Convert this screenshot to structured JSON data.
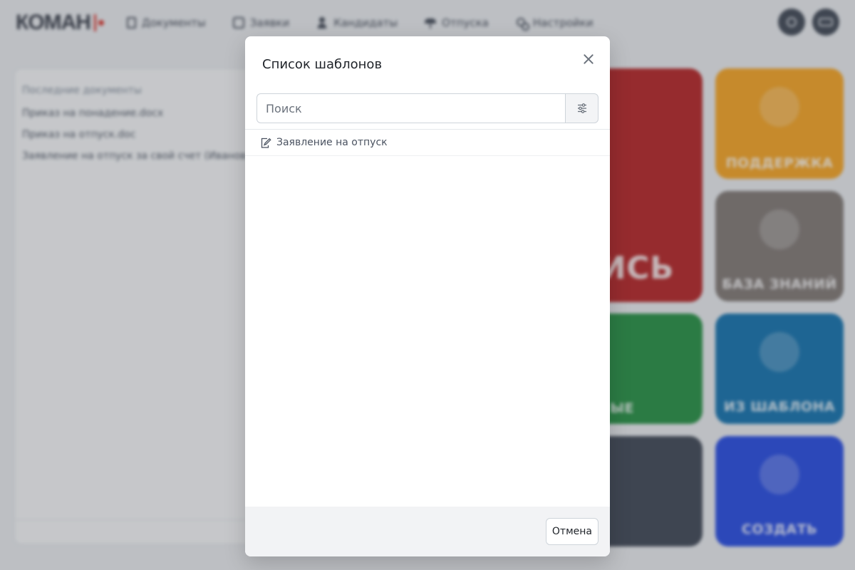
{
  "background": {
    "logo_text": "КОМАН",
    "nav": [
      {
        "label": "Документы",
        "icon": "document-edit-icon"
      },
      {
        "label": "Заявки",
        "icon": "request-icon"
      },
      {
        "label": "Кандидаты",
        "icon": "user-icon"
      },
      {
        "label": "Отпуска",
        "icon": "vacation-icon"
      },
      {
        "label": "Настройки",
        "icon": "settings-icon"
      }
    ],
    "recent_docs": {
      "title": "Последние документы",
      "items": [
        "Приказ на понадение.docx",
        "Приказ на отпуск.doc",
        "Заявление на отпуск за свой счет (Иванов"
      ]
    },
    "tiles": [
      {
        "label": "ИСЬ",
        "color": "#b31e1f"
      },
      {
        "label": "ПОДДЕРЖКА",
        "color": "#f5a11c"
      },
      {
        "label": "БАЗА ЗНАНИЙ",
        "color": "#7d7570"
      },
      {
        "label": "ЫЕ",
        "color": "#1f8c3d"
      },
      {
        "label": "ИЗ ШАБЛОНА",
        "color": "#0d6eab"
      },
      {
        "label": "",
        "color": "#3a4250"
      },
      {
        "label": "СОЗДАТЬ",
        "color": "#2046e0"
      }
    ]
  },
  "modal": {
    "title": "Список шаблонов",
    "search": {
      "placeholder": "Поиск",
      "value": ""
    },
    "filter_icon": "sliders-icon",
    "items": [
      {
        "label": "Заявление на отпуск",
        "icon": "document-edit-icon"
      }
    ],
    "cancel_label": "Отмена"
  }
}
